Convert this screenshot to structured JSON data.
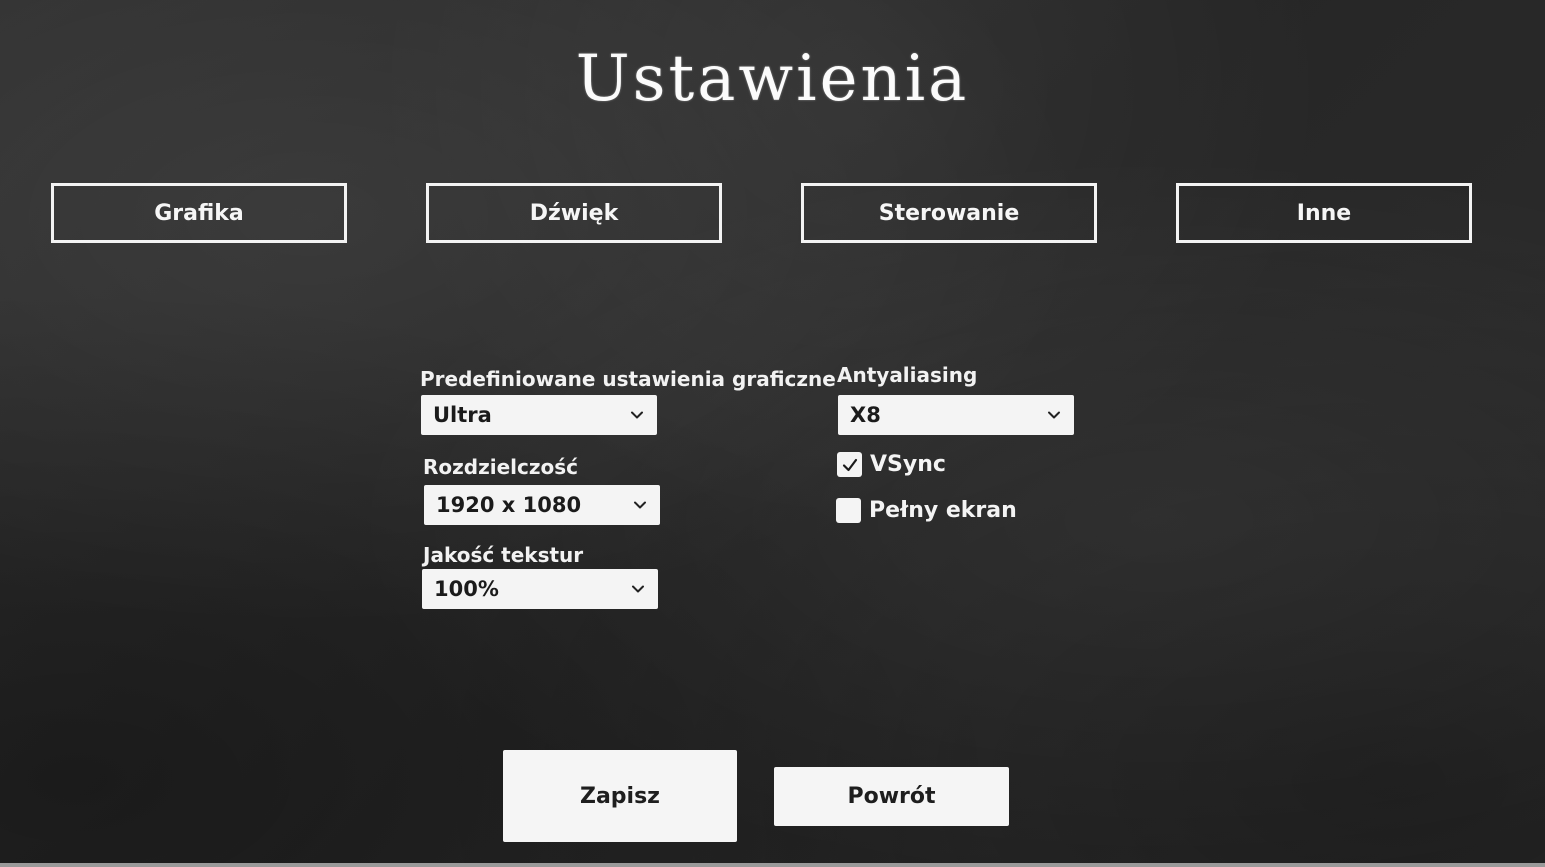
{
  "title": "Ustawienia",
  "tabs": [
    {
      "label": "Grafika"
    },
    {
      "label": "Dźwięk"
    },
    {
      "label": "Sterowanie"
    },
    {
      "label": "Inne"
    }
  ],
  "graphics": {
    "preset": {
      "label": "Predefiniowane ustawienia graficzne",
      "value": "Ultra"
    },
    "resolution": {
      "label": "Rozdzielczość",
      "value": "1920 x 1080"
    },
    "texture_quality": {
      "label": "Jakość tekstur",
      "value": "100%"
    },
    "antialiasing": {
      "label": "Antyaliasing",
      "value": "X8"
    },
    "vsync": {
      "label": "VSync",
      "checked": true
    },
    "fullscreen": {
      "label": "Pełny ekran",
      "checked": false
    }
  },
  "buttons": {
    "save": "Zapisz",
    "back": "Powrót"
  },
  "icons": {
    "dropdown": "chevron-down-icon",
    "checkmark": "check-icon"
  },
  "colors": {
    "board": "#2b2b2b",
    "chalk": "#f4f4f4",
    "control_text": "#1b1b1b"
  }
}
